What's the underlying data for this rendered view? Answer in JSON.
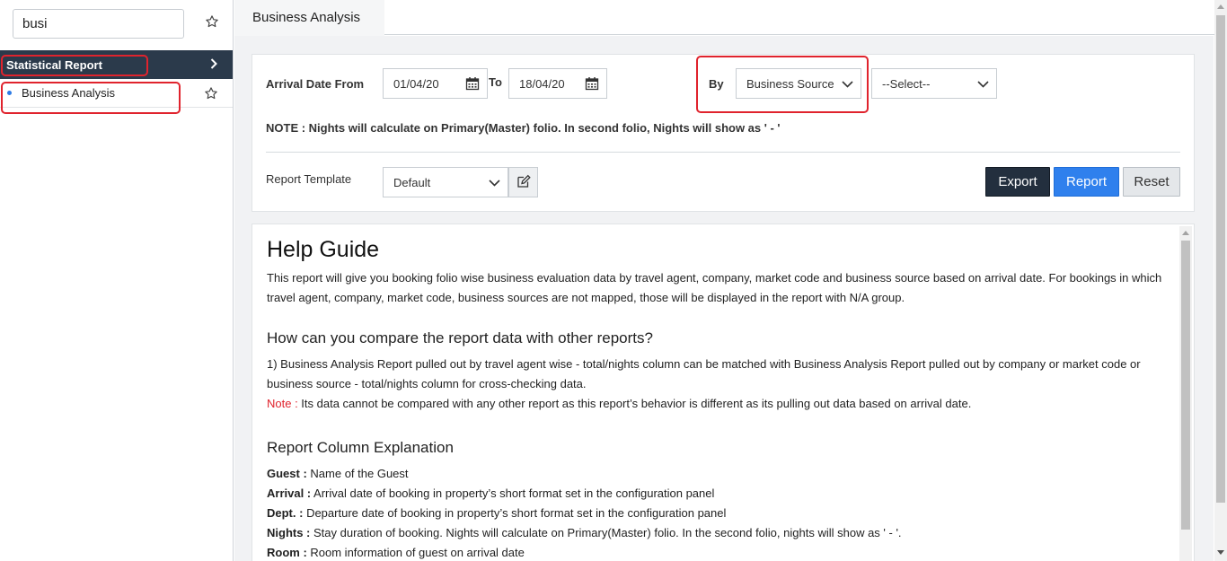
{
  "sidebar": {
    "search_value": "busi",
    "section_label": "Statistical Report",
    "item_label": "Business Analysis"
  },
  "tab": {
    "label": "Business Analysis"
  },
  "filters": {
    "arrival_from_label": "Arrival Date From",
    "arrival_from_value": "01/04/20",
    "to_label": "To",
    "to_value": "18/04/20",
    "by_label": "By",
    "by_value": "Business Source",
    "select_value": "--Select--",
    "note": "NOTE : Nights will calculate on Primary(Master) folio. In second folio, Nights will show as ' - '",
    "template_label": "Report Template",
    "template_value": "Default"
  },
  "buttons": {
    "export": "Export",
    "report": "Report",
    "reset": "Reset"
  },
  "help": {
    "title": "Help Guide",
    "intro": "This report will give you booking folio wise business evaluation data by travel agent, company, market code and business source based on arrival date. For bookings in which travel agent, company, market code, business sources are not mapped, those will be displayed in the report with N/A group.",
    "compare_heading": "How can you compare the report data with other reports?",
    "compare_text": "1) Business Analysis Report pulled out by travel agent wise - total/nights column can be matched with Business Analysis Report pulled out by company or market code or business source - total/nights column for cross-checking data.",
    "note_label": "Note :",
    "note_text": " Its data cannot be compared with any other report as this report’s behavior is different as its pulling out data based on arrival date.",
    "columns_heading": "Report Column Explanation",
    "columns": [
      {
        "name": "Guest :",
        "desc": " Name of the Guest"
      },
      {
        "name": "Arrival :",
        "desc": " Arrival date of booking in property’s short format set in the configuration panel"
      },
      {
        "name": "Dept. :",
        "desc": " Departure date of booking in property’s short format set in the configuration panel"
      },
      {
        "name": "Nights :",
        "desc": " Stay duration of booking. Nights will calculate on Primary(Master) folio. In the second folio, nights will show as ' - '."
      },
      {
        "name": "Room :",
        "desc": " Room information of guest on arrival date"
      }
    ]
  },
  "colors": {
    "sidebar_header": "#2b3a4b",
    "accent": "#2f80ed",
    "highlight": "#e0232d",
    "note_red": "#e0232d"
  }
}
